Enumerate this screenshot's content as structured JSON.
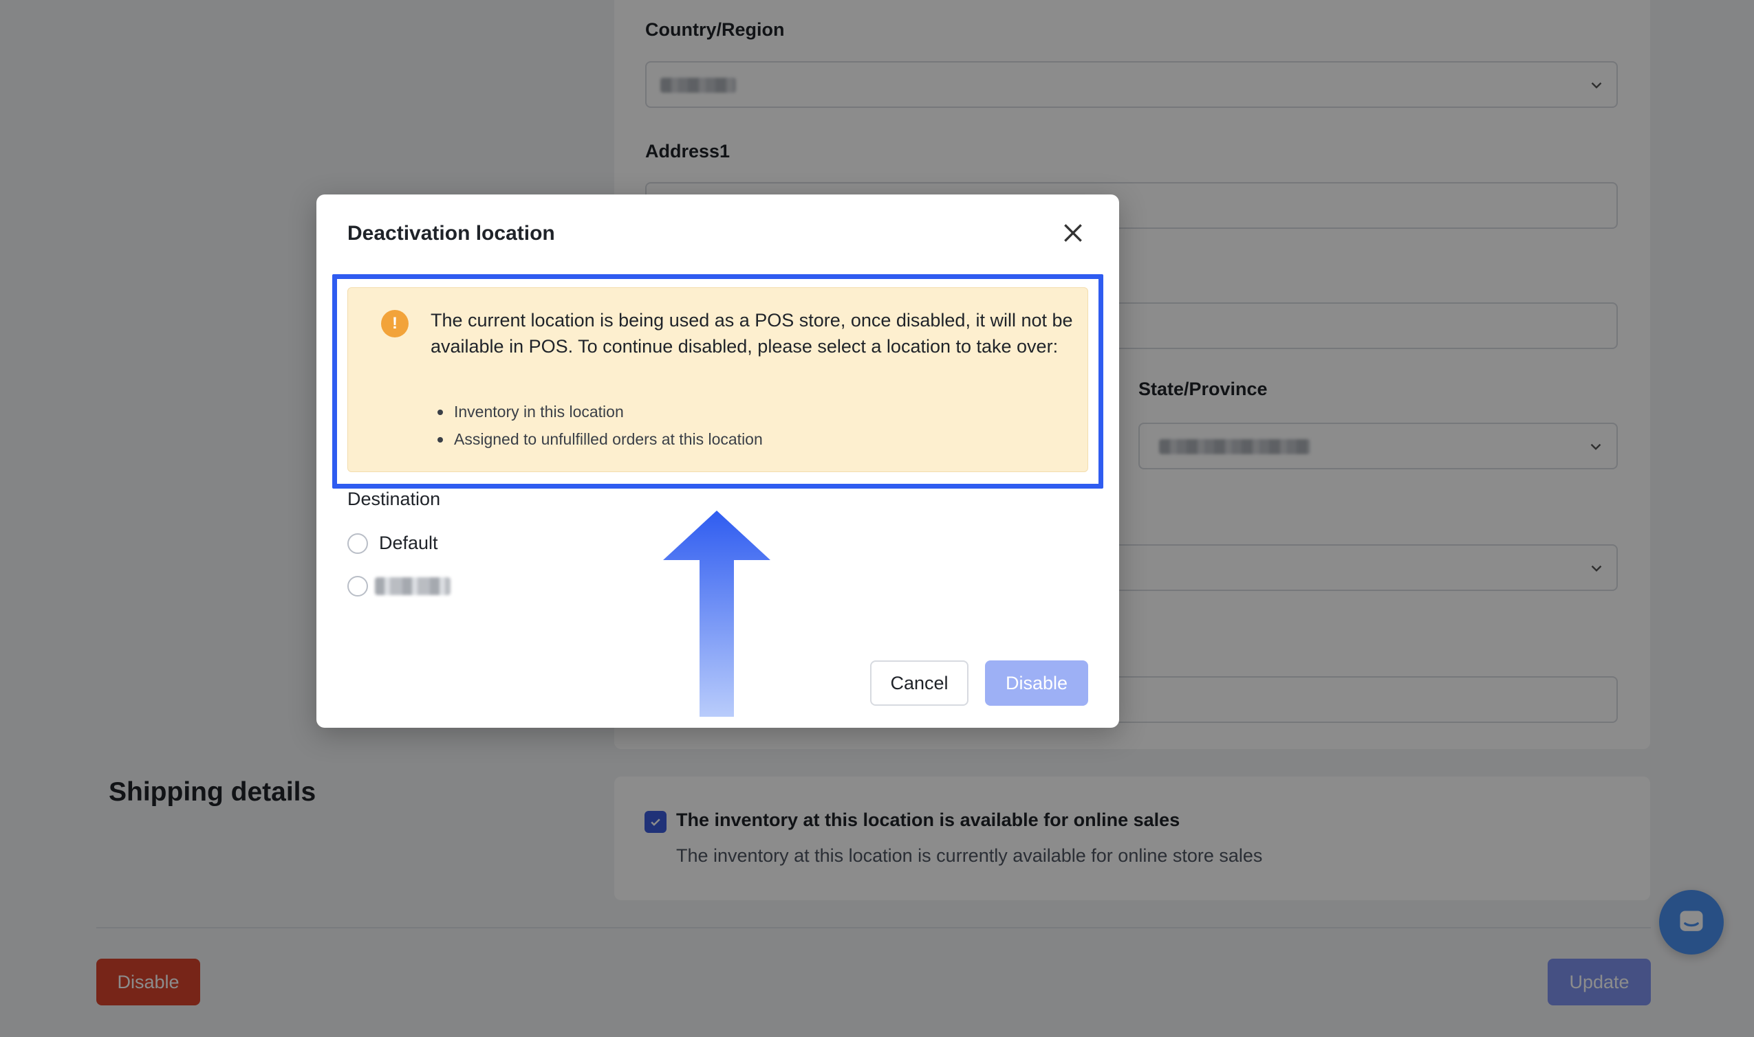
{
  "background_form": {
    "country_label": "Country/Region",
    "address1_label": "Address1",
    "state_label": "State/Province"
  },
  "shipping": {
    "section_title": "Shipping details",
    "online_sales_label": "The inventory at this location is available for online sales",
    "online_sales_desc": "The inventory at this location is currently available for online store sales",
    "online_sales_checked": true
  },
  "footer": {
    "disable_label": "Disable",
    "update_label": "Update"
  },
  "modal": {
    "title": "Deactivation location",
    "warning_text": "The current location is being used as a POS store, once disabled, it will not be available in POS. To continue disabled, please select a location to take over:",
    "warning_items": [
      "Inventory in this location",
      "Assigned to unfulfilled orders at this location"
    ],
    "destination_label": "Destination",
    "options": [
      "Default"
    ],
    "cancel_label": "Cancel",
    "disable_label": "Disable"
  },
  "icons": {
    "warning": "warning-icon",
    "close": "close-icon",
    "chat": "chat-icon",
    "chevron": "chevron-down-icon",
    "check": "checkmark-icon"
  },
  "colors": {
    "highlight": "#2f5cf0",
    "warning_bg": "#fdefcf",
    "warning_icon": "#f2a33a",
    "danger": "#d9442d",
    "primary_disabled": "#9db0f5"
  }
}
